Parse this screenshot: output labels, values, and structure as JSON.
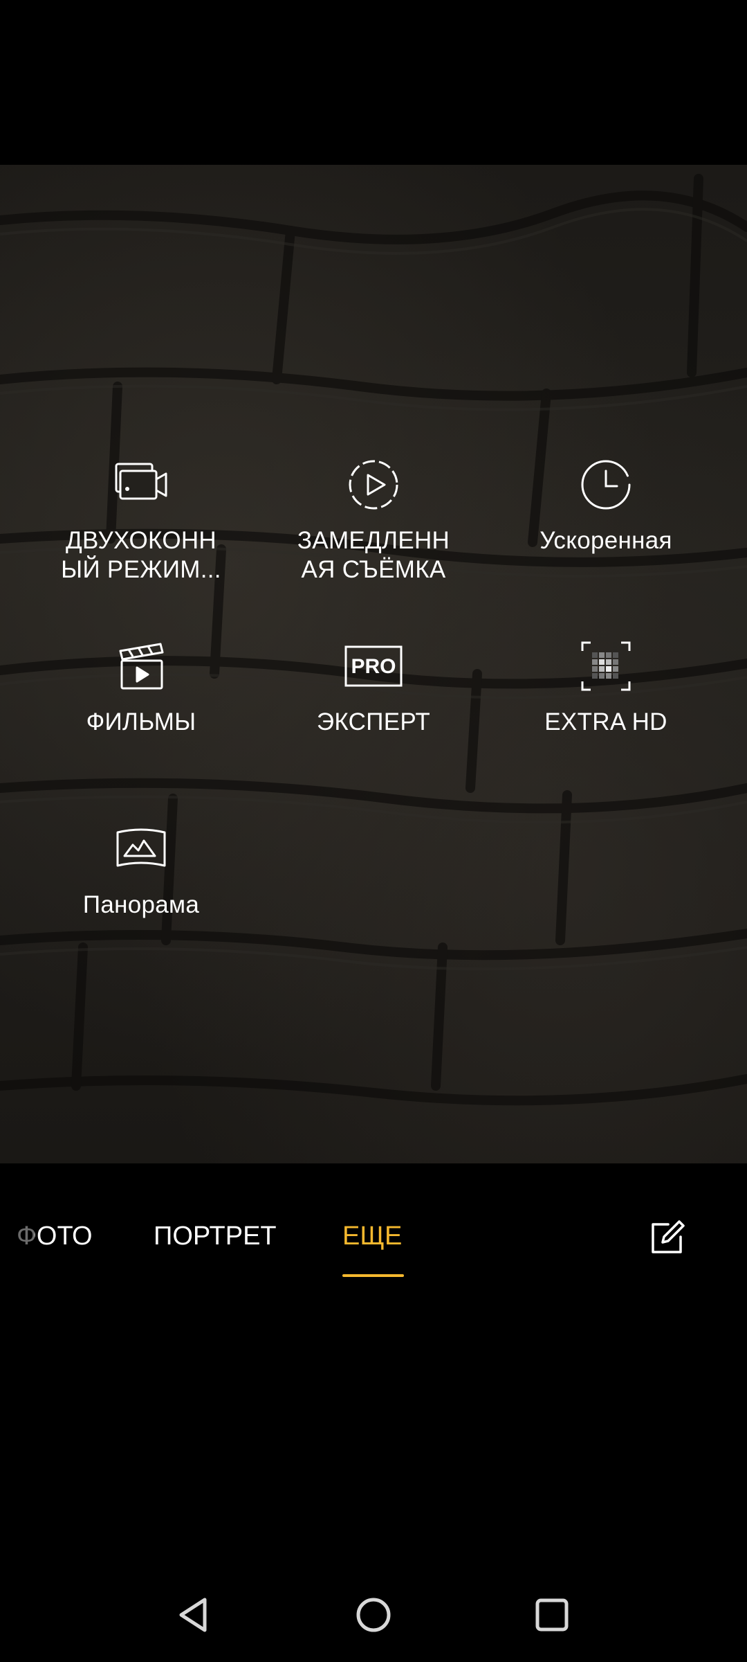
{
  "camera": {
    "modes": [
      {
        "label": "ДВУХОКОНН\nЫЙ РЕЖИМ...",
        "icon": "dual-view-video-icon"
      },
      {
        "label": "ЗАМЕДЛЕНН\nАЯ СЪЁМКА",
        "icon": "slow-motion-icon"
      },
      {
        "label": "Ускоренная",
        "icon": "time-lapse-icon"
      },
      {
        "label": "ФИЛЬМЫ",
        "icon": "movie-clapperboard-icon"
      },
      {
        "label": "ЭКСПЕРТ",
        "icon": "pro-mode-icon"
      },
      {
        "label": "EXTRA HD",
        "icon": "extra-hd-icon"
      },
      {
        "label": "Панорама",
        "icon": "panorama-icon"
      }
    ],
    "pro_icon_text": "PRO",
    "tabs": [
      {
        "label": "ФОТО"
      },
      {
        "label": "ПОРТРЕТ"
      },
      {
        "label": "ЕЩЕ",
        "selected": true
      }
    ],
    "edit_icon": "edit-square-icon"
  },
  "navigation": {
    "back_icon": "back-triangle-icon",
    "home_icon": "home-circle-icon",
    "recents_icon": "recents-square-icon"
  },
  "colors": {
    "accent": "#F5B82E",
    "text": "#FFFFFF",
    "nav_icon": "#D8D8D8"
  }
}
